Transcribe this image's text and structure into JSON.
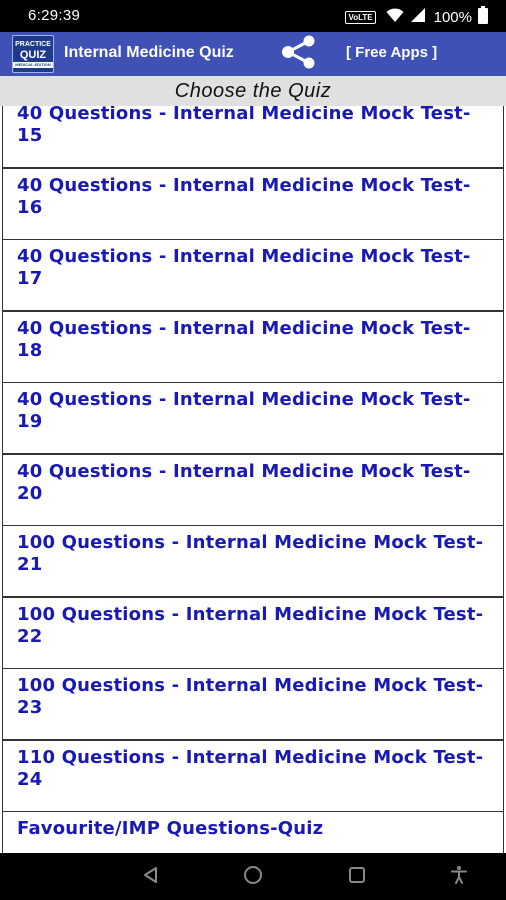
{
  "status_bar": {
    "time": "6:29:39",
    "network_badge": "VoLTE",
    "battery": "100%"
  },
  "app_bar": {
    "logo_line1": "PRACTICE",
    "logo_line2": "QUIZ",
    "logo_line3": "MEDICAL EDITION",
    "title": "Internal Medicine Quiz",
    "share_icon": "share-icon",
    "free_apps": "[ Free Apps ]",
    "color": "#3f51b5"
  },
  "subheader": {
    "text": "Choose the Quiz"
  },
  "quiz_list": [
    {
      "label": "40 Questions - Internal Medicine Mock Test-15"
    },
    {
      "label": "40 Questions - Internal Medicine Mock Test-16"
    },
    {
      "label": "40 Questions - Internal Medicine Mock Test-17"
    },
    {
      "label": "40 Questions - Internal Medicine Mock Test-18"
    },
    {
      "label": "40 Questions - Internal Medicine Mock Test-19"
    },
    {
      "label": "40 Questions - Internal Medicine Mock Test-20"
    },
    {
      "label": "100 Questions - Internal Medicine Mock Test-21"
    },
    {
      "label": "100 Questions - Internal Medicine Mock Test-22"
    },
    {
      "label": "100 Questions - Internal Medicine Mock Test-23"
    },
    {
      "label": "110 Questions - Internal Medicine Mock Test-24"
    },
    {
      "label": "Favourite/IMP Questions-Quiz"
    }
  ],
  "nav_bar": {
    "icons": [
      "back-icon",
      "home-icon",
      "recents-icon",
      "accessibility-icon"
    ]
  },
  "colors": {
    "item_text": "#1919b3",
    "subheader_bg": "#e0e0e0"
  }
}
